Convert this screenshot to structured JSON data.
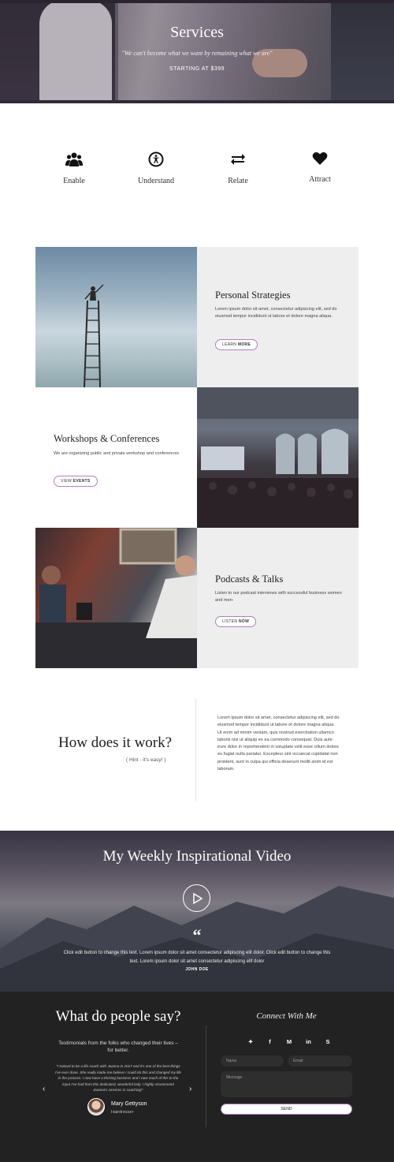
{
  "hero": {
    "title": "Services",
    "quote": "\"We can't become what we want by remaining what we are\"",
    "price": "STARTING AT $399"
  },
  "features": [
    {
      "label": "Enable",
      "icon": "group-icon"
    },
    {
      "label": "Understand",
      "icon": "accessibility-icon"
    },
    {
      "label": "Relate",
      "icon": "exchange-arrows-icon"
    },
    {
      "label": "Attract",
      "icon": "heart-icon"
    }
  ],
  "cards": [
    {
      "title": "Personal Strategies",
      "text": "Lorem ipsum dolor sit amet, consectetur adipiscing elit, sed do eiusmod tempor incididunt ut labore et dolore magna aliqua.",
      "btn_a": "LEARN",
      "btn_b": "MORE"
    },
    {
      "title": "Workshops & Conferences",
      "text": "We are organizing public and private workshop and conferences",
      "btn_a": "VIEW",
      "btn_b": "EVENTS"
    },
    {
      "title": "Podcasts & Talks",
      "text": "Listen to our podcast interviews with successful business women and men-",
      "btn_a": "LISTEN",
      "btn_b": "NOW"
    }
  ],
  "how": {
    "title": "How does it work?",
    "hint": "( Hint - it's easy! )",
    "text": "Lorem ipsum dolor sit amet, consectetur adipiscing elit, sed do eiusmod tempor incididunt ut labore et dolore magna aliqua. Ut enim ad minim veniam, quis nostrud exercitation ullamco laboris nisi ut aliquip ex ea commodo consequat. Duis aute irure dolor in reprehenderit in voluptate velit esse cillum dolore eu fugiat nulla pariatur. Excepteur sint occaecat cupidatat non proident, sunt in culpa qui officia deserunt mollit anim id est laborum."
  },
  "video": {
    "title": "My Weekly Inspirational Video",
    "quote_mark": "“",
    "text": "Click edit button to change this text. Lorem ipsum dolor sit amet consectetur adipiscing elit dolor. Click edit button to change this text. Lorem ipsum dolor sit amet consectetur adipiscing elit dolor",
    "author": "JOHN DOE"
  },
  "testimonials": {
    "title": "What do people say?",
    "subtitle": "Testimonials from the folks who changed their lives – for better.",
    "quote": "\"I trained to be a life coach with Joanna in 2017 and it's one of the best things I've ever done. She really made me believe I could do this and changed my life in the process. I now have a thriving business and I owe much of this to the input I've had from this dedicated, wonderful lady. I highly recommend Joanna's services in coaching!\"",
    "name": "Mary Gettyson",
    "role": "Hairdresser",
    "prev": "‹",
    "next": "›"
  },
  "connect": {
    "title": "Connect With Me",
    "socials": [
      "✦",
      "f",
      "M",
      "in",
      "S"
    ],
    "name_placeholder": "Name",
    "email_placeholder": "Email",
    "message_placeholder": "Message",
    "send": "SEND"
  }
}
